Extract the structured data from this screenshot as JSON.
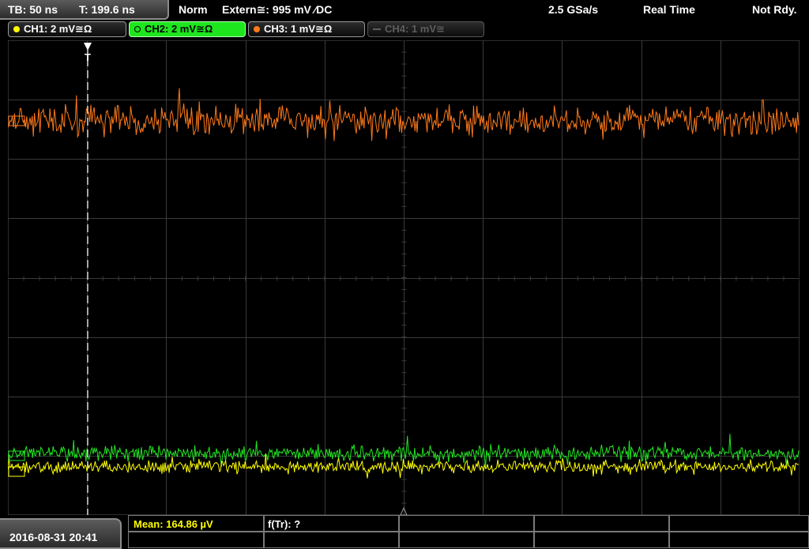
{
  "status": {
    "timebase": "TB: 50 ns",
    "trigger_time": "T: 199.6 ns",
    "trigger_mode": "Norm",
    "trigger_source": "Extern≅: 995 mV ⁄DC",
    "sample_rate": "2.5 GSa/s",
    "acq_mode": "Real Time",
    "run_state": "Not Rdy."
  },
  "channels": [
    {
      "id": "ch1",
      "label": "CH1: 2 mV≅Ω",
      "color": "#ffff00",
      "state": "on"
    },
    {
      "id": "ch2",
      "label": "CH2: 2 mV≅Ω",
      "color": "#20e020",
      "state": "selected"
    },
    {
      "id": "ch3",
      "label": "CH3: 1 mV≅Ω",
      "color": "#ff7a1a",
      "state": "on"
    },
    {
      "id": "ch4",
      "label": "CH4: 1 mV≅",
      "color": "#5d5d5d",
      "state": "off"
    }
  ],
  "trigger_marker": "T",
  "datetime": "2016-08-31 20:41",
  "measurements": {
    "mean": "Mean: 164.86 µV",
    "freq": "f(Tr): ?"
  },
  "colors": {
    "grid": "#3a3a3a",
    "ch1": "#ffff00",
    "ch2": "#22e622",
    "ch3": "#ff7a1a",
    "trigger_line": "#ffffff"
  }
}
